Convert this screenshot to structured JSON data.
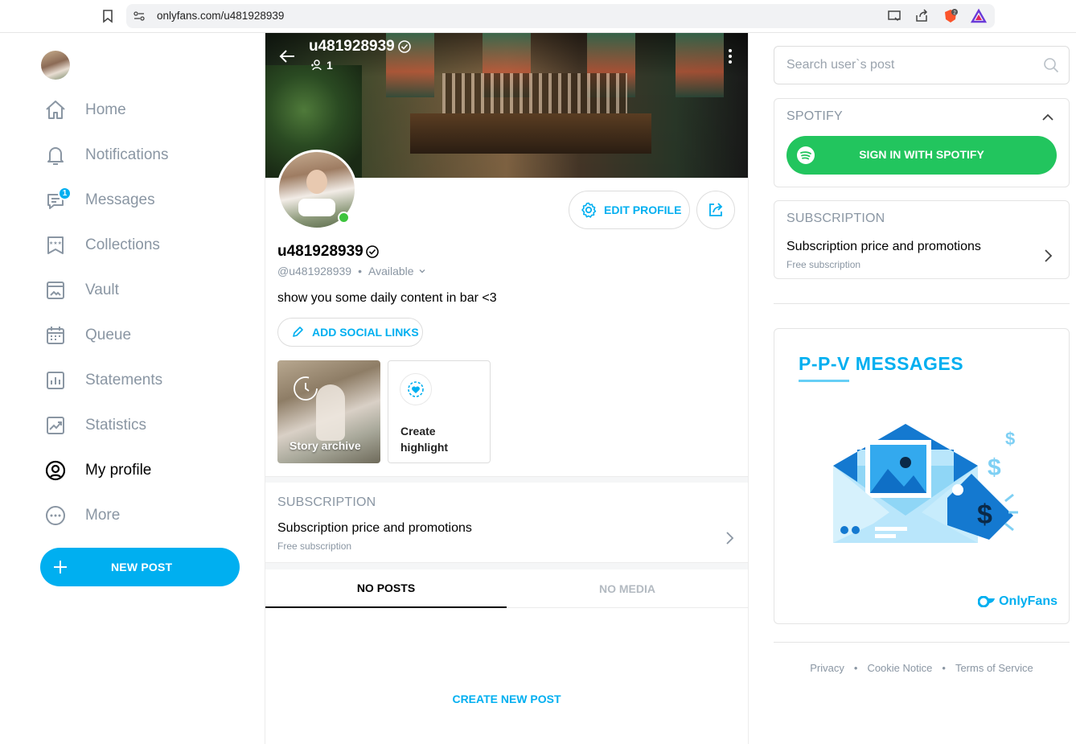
{
  "browser": {
    "url": "onlyfans.com/u481928939",
    "extension_badge": "2"
  },
  "sidebar": {
    "items": [
      {
        "label": "Home",
        "icon": "home-icon"
      },
      {
        "label": "Notifications",
        "icon": "bell-icon"
      },
      {
        "label": "Messages",
        "icon": "chat-icon",
        "badge": "1"
      },
      {
        "label": "Collections",
        "icon": "bookmark-stars-icon"
      },
      {
        "label": "Vault",
        "icon": "image-folder-icon"
      },
      {
        "label": "Queue",
        "icon": "calendar-icon"
      },
      {
        "label": "Statements",
        "icon": "bar-chart-icon"
      },
      {
        "label": "Statistics",
        "icon": "trend-chart-icon"
      },
      {
        "label": "My profile",
        "icon": "user-circle-icon",
        "active": true
      },
      {
        "label": "More",
        "icon": "dots-circle-icon"
      }
    ],
    "new_post": "NEW POST"
  },
  "cover": {
    "title": "u481928939",
    "fans_count": "1"
  },
  "profile": {
    "name": "u481928939",
    "handle": "@u481928939",
    "status": "Available",
    "bio": "show you some daily content in bar <3",
    "edit_profile": "EDIT PROFILE",
    "add_social_links": "ADD SOCIAL LINKS",
    "highlights": {
      "archive": "Story archive",
      "create": "Create highlight"
    }
  },
  "subscription": {
    "title": "SUBSCRIPTION",
    "row_title": "Subscription price and promotions",
    "row_sub": "Free subscription"
  },
  "tabs": [
    {
      "label": "NO POSTS",
      "active": true
    },
    {
      "label": "NO MEDIA",
      "active": false
    }
  ],
  "create_new_post": "CREATE NEW POST",
  "right": {
    "search_placeholder": "Search user`s post",
    "spotify_title": "SPOTIFY",
    "spotify_button": "SIGN IN WITH SPOTIFY",
    "sub_title": "SUBSCRIPTION",
    "sub_row_title": "Subscription price and promotions",
    "sub_row_sub": "Free subscription",
    "promo_title": "P-P-V  MESSAGES",
    "promo_brand": "OnlyFans",
    "footer": [
      "Privacy",
      "Cookie Notice",
      "Terms of Service"
    ]
  },
  "colors": {
    "accent": "#00aff0",
    "spotify_green": "#22c55e",
    "muted": "#8a96a3",
    "online": "#3ec43e"
  }
}
